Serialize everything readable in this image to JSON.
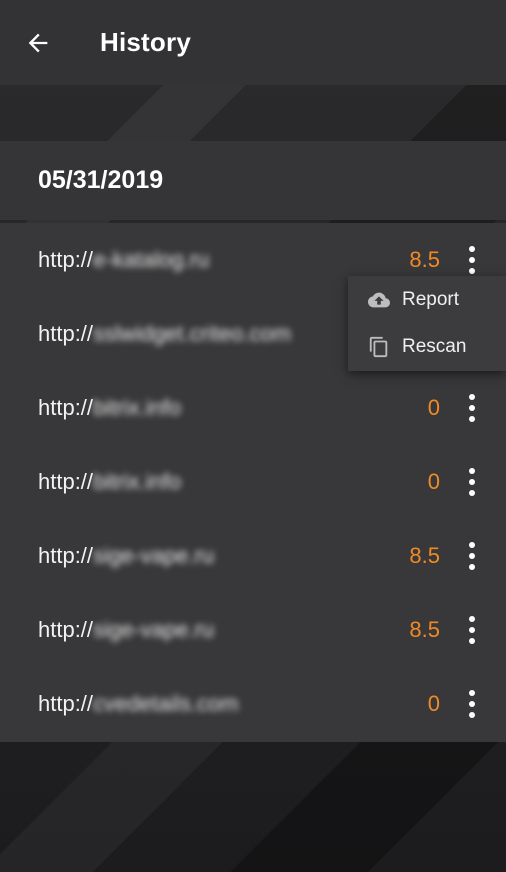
{
  "header": {
    "title": "History",
    "back_icon": "arrow-left-icon"
  },
  "section": {
    "date": "05/31/2019"
  },
  "rows": [
    {
      "proto": "http://",
      "host": "e-katalog.ru",
      "score": "8.5"
    },
    {
      "proto": "http://",
      "host": "sslwidget.criteo.com",
      "score": ""
    },
    {
      "proto": "http://",
      "host": "bitrix.info",
      "score": "0"
    },
    {
      "proto": "http://",
      "host": "bitrix.info",
      "score": "0"
    },
    {
      "proto": "http://",
      "host": "sige-vape.ru",
      "score": "8.5"
    },
    {
      "proto": "http://",
      "host": "sige-vape.ru",
      "score": "8.5"
    },
    {
      "proto": "http://",
      "host": "cvedetails.com",
      "score": "0"
    }
  ],
  "menu": {
    "report": {
      "label": "Report",
      "icon": "cloud-upload-icon"
    },
    "rescan": {
      "label": "Rescan",
      "icon": "copy-icon"
    }
  },
  "colors": {
    "accent": "#f08a24",
    "appbar": "#333335",
    "list_bg": "#38383a"
  }
}
